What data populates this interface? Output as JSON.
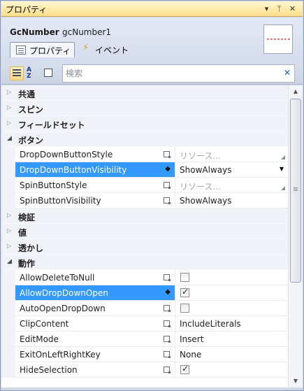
{
  "window": {
    "title": "プロパティ",
    "buttons": {
      "dropdown": "▾",
      "pin": "ᛘ",
      "close": "✕"
    }
  },
  "header": {
    "object_type": "GcNumber",
    "object_name": "gcNumber1",
    "tabs": [
      {
        "label": "プロパティ",
        "icon": "property-pages-icon",
        "active": true
      },
      {
        "label": "イベント",
        "icon": "lightning-icon",
        "active": false
      }
    ]
  },
  "toolbar": {
    "search_placeholder": "検索",
    "search_value": "",
    "clear": "✕"
  },
  "grid": {
    "sections": [
      {
        "category": "共通",
        "expanded": false,
        "rows": []
      },
      {
        "category": "スピン",
        "expanded": false,
        "rows": []
      },
      {
        "category": "フィールドセット",
        "expanded": false,
        "rows": []
      },
      {
        "category": "ボタン",
        "expanded": true,
        "rows": [
          {
            "name": "DropDownButtonStyle",
            "value": "リソース...",
            "value_kind": "resource",
            "marker": "box"
          },
          {
            "name": "DropDownButtonVisibility",
            "value": "ShowAlways",
            "value_kind": "dropdown",
            "marker": "diamond",
            "selected": true
          },
          {
            "name": "SpinButtonStyle",
            "value": "リソース...",
            "value_kind": "resource",
            "marker": "box"
          },
          {
            "name": "SpinButtonVisibility",
            "value": "ShowAlways",
            "value_kind": "text",
            "marker": "box"
          }
        ]
      },
      {
        "category": "検証",
        "expanded": false,
        "rows": []
      },
      {
        "category": "値",
        "expanded": false,
        "rows": []
      },
      {
        "category": "透かし",
        "expanded": false,
        "rows": []
      },
      {
        "category": "動作",
        "expanded": true,
        "rows": [
          {
            "name": "AllowDeleteToNull",
            "value_kind": "checkbox",
            "checked": false,
            "marker": "box"
          },
          {
            "name": "AllowDropDownOpen",
            "value_kind": "checkbox",
            "checked": true,
            "marker": "diamond",
            "selected": true
          },
          {
            "name": "AutoOpenDropDown",
            "value_kind": "checkbox",
            "checked": false,
            "marker": "box"
          },
          {
            "name": "ClipContent",
            "value": "IncludeLiterals",
            "value_kind": "text",
            "marker": "box"
          },
          {
            "name": "EditMode",
            "value": "Insert",
            "value_kind": "text",
            "marker": "box"
          },
          {
            "name": "ExitOnLeftRightKey",
            "value": "None",
            "value_kind": "text",
            "marker": "box"
          },
          {
            "name": "HideSelection",
            "value_kind": "checkbox",
            "checked": true,
            "marker": "box"
          }
        ]
      }
    ]
  },
  "colors": {
    "selection": "#3399ff",
    "titlebar": "#ffe9a7",
    "panel": "#cfd6e5"
  }
}
